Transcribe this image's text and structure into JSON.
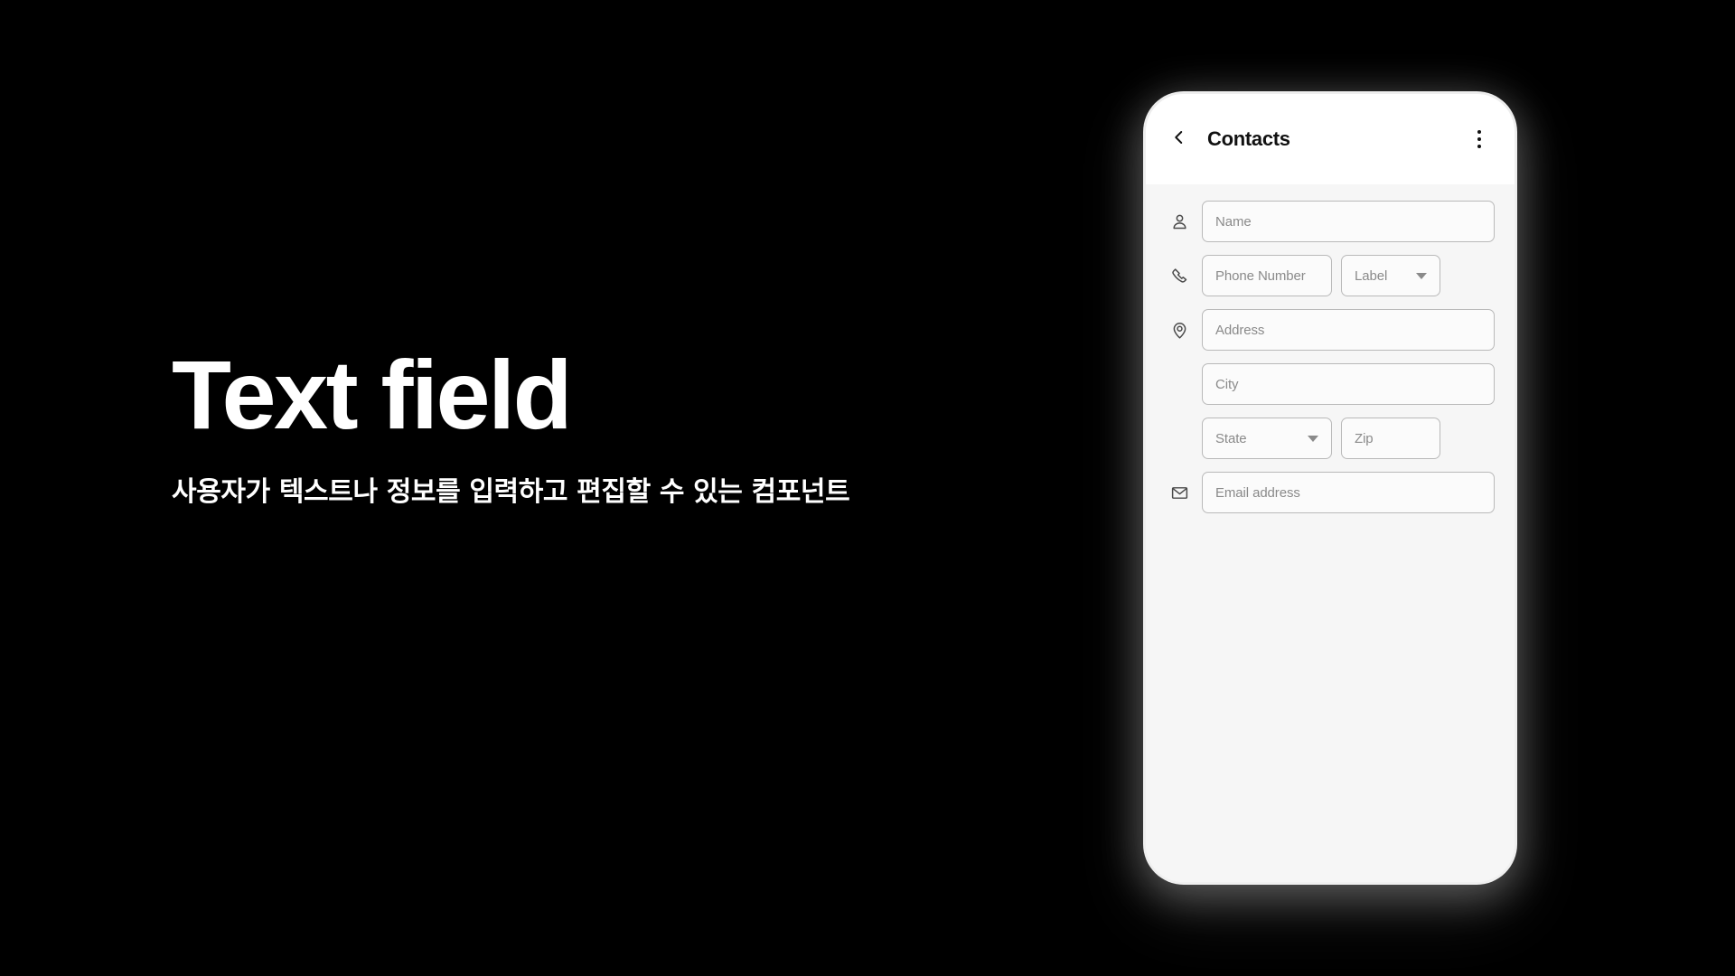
{
  "page": {
    "background_color": "#000000",
    "title": "Text field",
    "subtitle": "사용자가 텍스트나 정보를 입력하고 편집할 수 있는 컴포넌트"
  },
  "phone": {
    "appbar": {
      "back_icon": "chevron-left-icon",
      "title": "Contacts",
      "overflow_icon": "more-vertical-icon"
    },
    "form": {
      "background_color": "#f6f6f6",
      "field_border_color": "#b9b9b9",
      "placeholder_color": "#8a8a8a",
      "rows": [
        {
          "icon": "person-icon",
          "fields": [
            {
              "name": "name-field",
              "placeholder": "Name",
              "type": "text"
            }
          ]
        },
        {
          "icon": "phone-icon",
          "fields": [
            {
              "name": "phone-number-field",
              "placeholder": "Phone Number",
              "type": "text"
            },
            {
              "name": "phone-label-select",
              "placeholder": "Label",
              "type": "select"
            }
          ]
        },
        {
          "icon": "location-pin-icon",
          "fields": [
            {
              "name": "address-field",
              "placeholder": "Address",
              "type": "text"
            }
          ]
        },
        {
          "icon": "none",
          "fields": [
            {
              "name": "city-field",
              "placeholder": "City",
              "type": "text"
            }
          ]
        },
        {
          "icon": "none",
          "fields": [
            {
              "name": "state-select",
              "placeholder": "State",
              "type": "select"
            },
            {
              "name": "zip-field",
              "placeholder": "Zip",
              "type": "text"
            }
          ]
        },
        {
          "icon": "mail-icon",
          "fields": [
            {
              "name": "email-address-field",
              "placeholder": "Email address",
              "type": "text"
            }
          ]
        }
      ]
    }
  }
}
